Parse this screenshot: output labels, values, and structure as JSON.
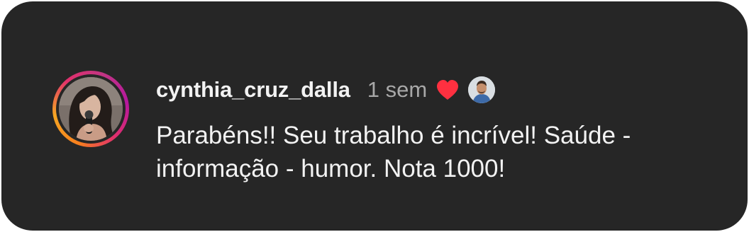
{
  "comment": {
    "author": {
      "username": "cynthia_cruz_dalla",
      "avatar_icon": "profile-photo-woman-with-microphone",
      "story_ring_colors": [
        "#f77f1d",
        "#e1306c",
        "#c13584"
      ]
    },
    "timestamp": "1 sem",
    "liked_by_creator": {
      "icon": "heart-icon",
      "color": "#ff3040",
      "creator_avatar_icon": "profile-photo-man"
    },
    "text": "Parabéns!! Seu trabalho é incrível! Saúde - informação - humor. Nota 1000!"
  },
  "theme": {
    "background": "#262626",
    "text_primary": "#f2f2f2",
    "text_secondary": "#a8a8a8"
  }
}
